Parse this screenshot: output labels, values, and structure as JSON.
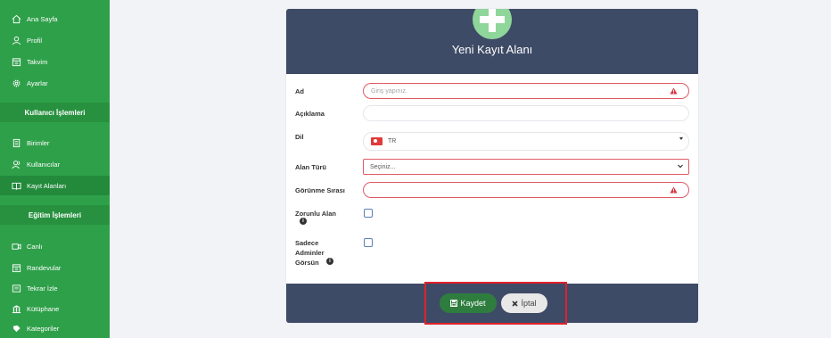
{
  "sidebar": {
    "items_top": [
      {
        "label": "Ana Sayfa",
        "icon": "home-icon"
      },
      {
        "label": "Profil",
        "icon": "user-icon"
      },
      {
        "label": "Takvim",
        "icon": "calendar-icon"
      },
      {
        "label": "Ayarlar",
        "icon": "gear-icon"
      }
    ],
    "section_users": "Kullanıcı İşlemleri",
    "items_users": [
      {
        "label": "Birimler",
        "icon": "document-icon"
      },
      {
        "label": "Kullanıcılar",
        "icon": "users-icon"
      },
      {
        "label": "Kayıt Alanları",
        "icon": "book-icon"
      }
    ],
    "section_edu": "Eğitim İşlemleri",
    "items_edu": [
      {
        "label": "Canlı",
        "icon": "video-icon"
      },
      {
        "label": "Randevular",
        "icon": "calendar-icon"
      },
      {
        "label": "Tekrar İzle",
        "icon": "replay-icon"
      },
      {
        "label": "Kütüphane",
        "icon": "library-icon"
      },
      {
        "label": "Kategoriler",
        "icon": "tag-icon"
      }
    ],
    "active_item": "Kayıt Alanları"
  },
  "form": {
    "title": "Yeni Kayıt Alanı",
    "ad_label": "Ad",
    "ad_placeholder": "Giriş yapınız.",
    "aciklama_label": "Açıklama",
    "dil_label": "Dil",
    "dil_value": "TR",
    "alan_turu_label": "Alan Türü",
    "alan_turu_value": "Seçiniz...",
    "gorunme_label": "Görünme Sırası",
    "zorunlu_label": "Zorunlu Alan",
    "sadece_label_1": "Sadece",
    "sadece_label_2": "Adminler",
    "sadece_label_3": "Görsün",
    "info_glyph": "i"
  },
  "footer": {
    "save_label": "Kaydet",
    "cancel_label": "İptal"
  },
  "colors": {
    "sidebar_bg": "#2fa04a",
    "header_bg": "#3e4b66",
    "error_border": "#e05a66",
    "save_bg": "#2e7d3f",
    "highlight": "#e0212b"
  }
}
